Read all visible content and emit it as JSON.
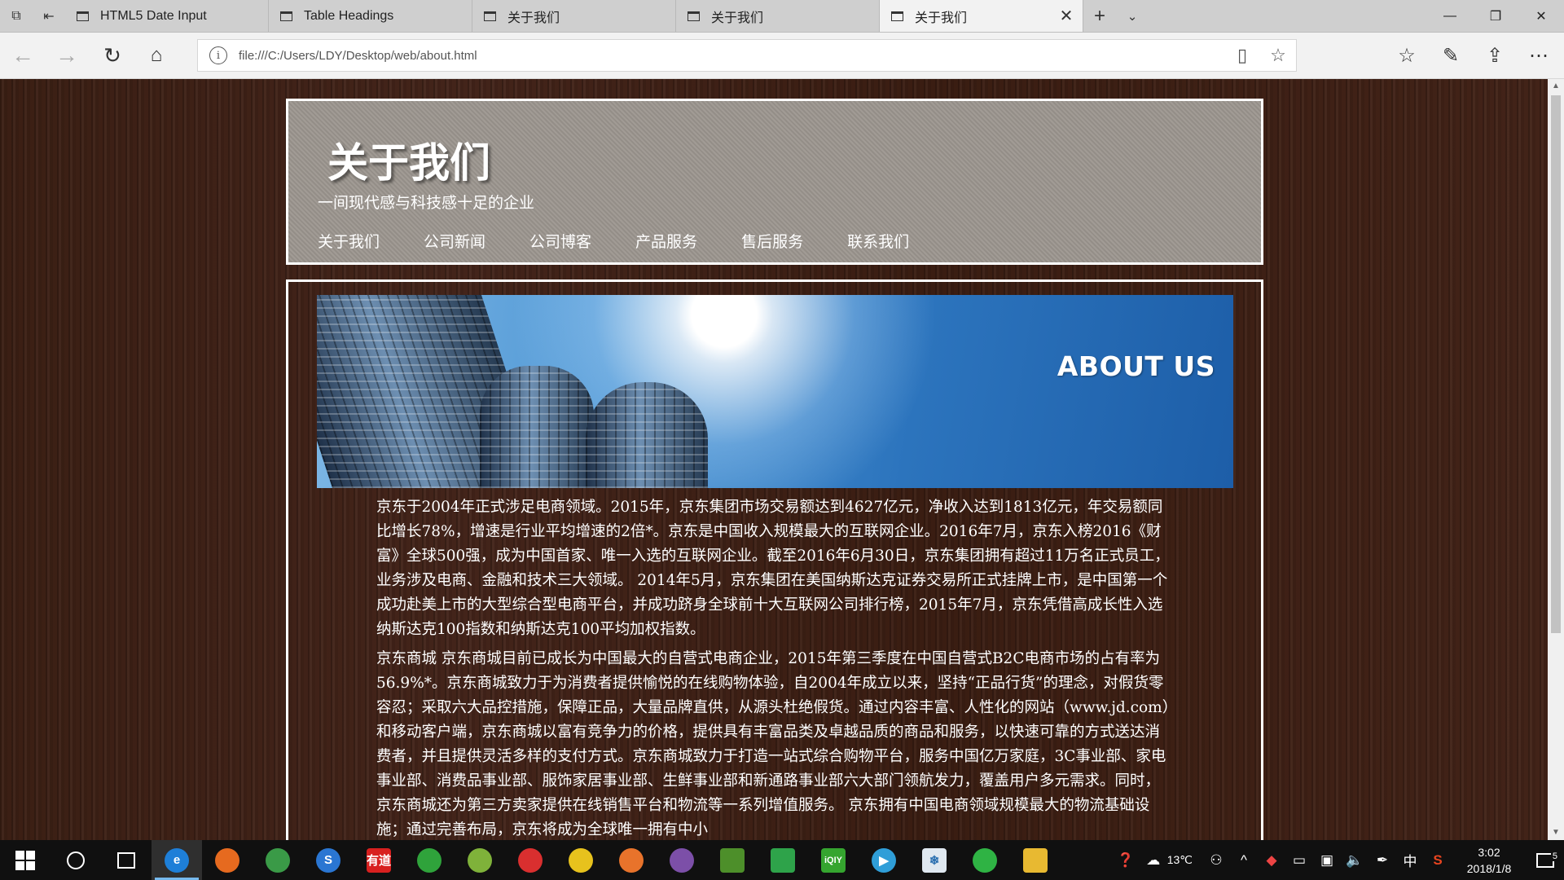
{
  "browser": {
    "tabs": [
      {
        "label": "HTML5 Date Input",
        "active": false
      },
      {
        "label": "Table Headings",
        "active": false
      },
      {
        "label": "关于我们",
        "active": false
      },
      {
        "label": "关于我们",
        "active": false
      },
      {
        "label": "关于我们",
        "active": true
      }
    ],
    "address": "file:///C:/Users/LDY/Desktop/web/about.html"
  },
  "page": {
    "title": "关于我们",
    "subtitle": "一间现代感与科技感十足的企业",
    "nav": [
      "关于我们",
      "公司新闻",
      "公司博客",
      "产品服务",
      "售后服务",
      "联系我们"
    ],
    "banner_text": "ABOUT US",
    "paragraphs": [
      "京东于2004年正式涉足电商领域。2015年，京东集团市场交易额达到4627亿元，净收入达到1813亿元，年交易额同比增长78%，增速是行业平均增速的2倍*。京东是中国收入规模最大的互联网企业。2016年7月，京东入榜2016《财富》全球500强，成为中国首家、唯一入选的互联网企业。截至2016年6月30日，京东集团拥有超过11万名正式员工，业务涉及电商、金融和技术三大领域。 2014年5月，京东集团在美国纳斯达克证券交易所正式挂牌上市，是中国第一个成功赴美上市的大型综合型电商平台，并成功跻身全球前十大互联网公司排行榜，2015年7月，京东凭借高成长性入选纳斯达克100指数和纳斯达克100平均加权指数。",
      "京东商城 京东商城目前已成长为中国最大的自营式电商企业，2015年第三季度在中国自营式B2C电商市场的占有率为56.9%*。京东商城致力于为消费者提供愉悦的在线购物体验，自2004年成立以来，坚持“正品行货”的理念，对假货零容忍；采取六大品控措施，保障正品，大量品牌直供，从源头杜绝假货。通过内容丰富、人性化的网站（www.jd.com）和移动客户端，京东商城以富有竞争力的价格，提供具有丰富品类及卓越品质的商品和服务，以快速可靠的方式送达消费者，并且提供灵活多样的支付方式。京东商城致力于打造一站式综合购物平台，服务中国亿万家庭，3C事业部、家电事业部、消费品事业部、服饰家居事业部、生鲜事业部和新通路事业部六大部门领航发力，覆盖用户多元需求。同时，京东商城还为第三方卖家提供在线销售平台和物流等一系列增值服务。 京东拥有中国电商领域规模最大的物流基础设施；通过完善布局，京东将成为全球唯一拥有中小"
    ]
  },
  "taskbar": {
    "apps": [
      {
        "icon": "edge-icon",
        "glyph": "e",
        "color": "#1e7fd8",
        "active": true
      },
      {
        "icon": "firefox-icon",
        "glyph": "",
        "color": "#e66a1f",
        "active": false
      },
      {
        "icon": "chrome-icon",
        "glyph": "",
        "color": "#3a9a47",
        "active": false
      },
      {
        "icon": "sogou-browser-icon",
        "glyph": "S",
        "color": "#2a76d2",
        "active": false
      },
      {
        "icon": "youdao-icon",
        "glyph": "有道",
        "color": "#d8201f",
        "active": false
      },
      {
        "icon": "360-icon",
        "glyph": "",
        "color": "#2fa33b",
        "active": false
      },
      {
        "icon": "map-icon",
        "glyph": "",
        "color": "#7fb23a",
        "active": false
      },
      {
        "icon": "netease-music-icon",
        "glyph": "",
        "color": "#d92f2f",
        "active": false
      },
      {
        "icon": "player-icon",
        "glyph": "",
        "color": "#e7c21d",
        "active": false
      },
      {
        "icon": "weibo-icon",
        "glyph": "",
        "color": "#e8732b",
        "active": false
      },
      {
        "icon": "github-icon",
        "glyph": "",
        "color": "#7c4fa8",
        "active": false
      },
      {
        "icon": "editor-icon",
        "glyph": "",
        "color": "#4d8f2a",
        "active": false
      },
      {
        "icon": "recycle-icon",
        "glyph": "",
        "color": "#2ea34a",
        "active": false
      },
      {
        "icon": "iqiyi-icon",
        "glyph": "iQIY",
        "color": "#35a52f",
        "active": false
      },
      {
        "icon": "video-player-icon",
        "glyph": "▶",
        "color": "#2f9ed8",
        "active": false
      },
      {
        "icon": "snowflake-app-icon",
        "glyph": "❄",
        "color": "#dfe8f0",
        "active": false
      },
      {
        "icon": "wechat-icon",
        "glyph": "",
        "color": "#2fb344",
        "active": false
      },
      {
        "icon": "file-explorer-icon",
        "glyph": "",
        "color": "#e8b931",
        "active": false
      }
    ],
    "weather": "13℃",
    "ime": "中",
    "time": "3:02",
    "date": "2018/1/8",
    "notifications": "5"
  }
}
